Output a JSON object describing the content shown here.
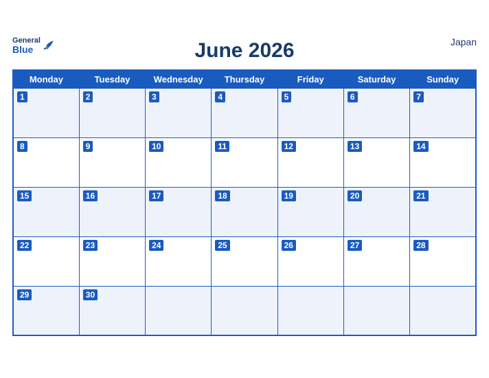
{
  "header": {
    "title": "June 2026",
    "country": "Japan",
    "logo_general": "General",
    "logo_blue": "Blue"
  },
  "weekdays": [
    "Monday",
    "Tuesday",
    "Wednesday",
    "Thursday",
    "Friday",
    "Saturday",
    "Sunday"
  ],
  "weeks": [
    [
      1,
      2,
      3,
      4,
      5,
      6,
      7
    ],
    [
      8,
      9,
      10,
      11,
      12,
      13,
      14
    ],
    [
      15,
      16,
      17,
      18,
      19,
      20,
      21
    ],
    [
      22,
      23,
      24,
      25,
      26,
      27,
      28
    ],
    [
      29,
      30,
      null,
      null,
      null,
      null,
      null
    ]
  ]
}
